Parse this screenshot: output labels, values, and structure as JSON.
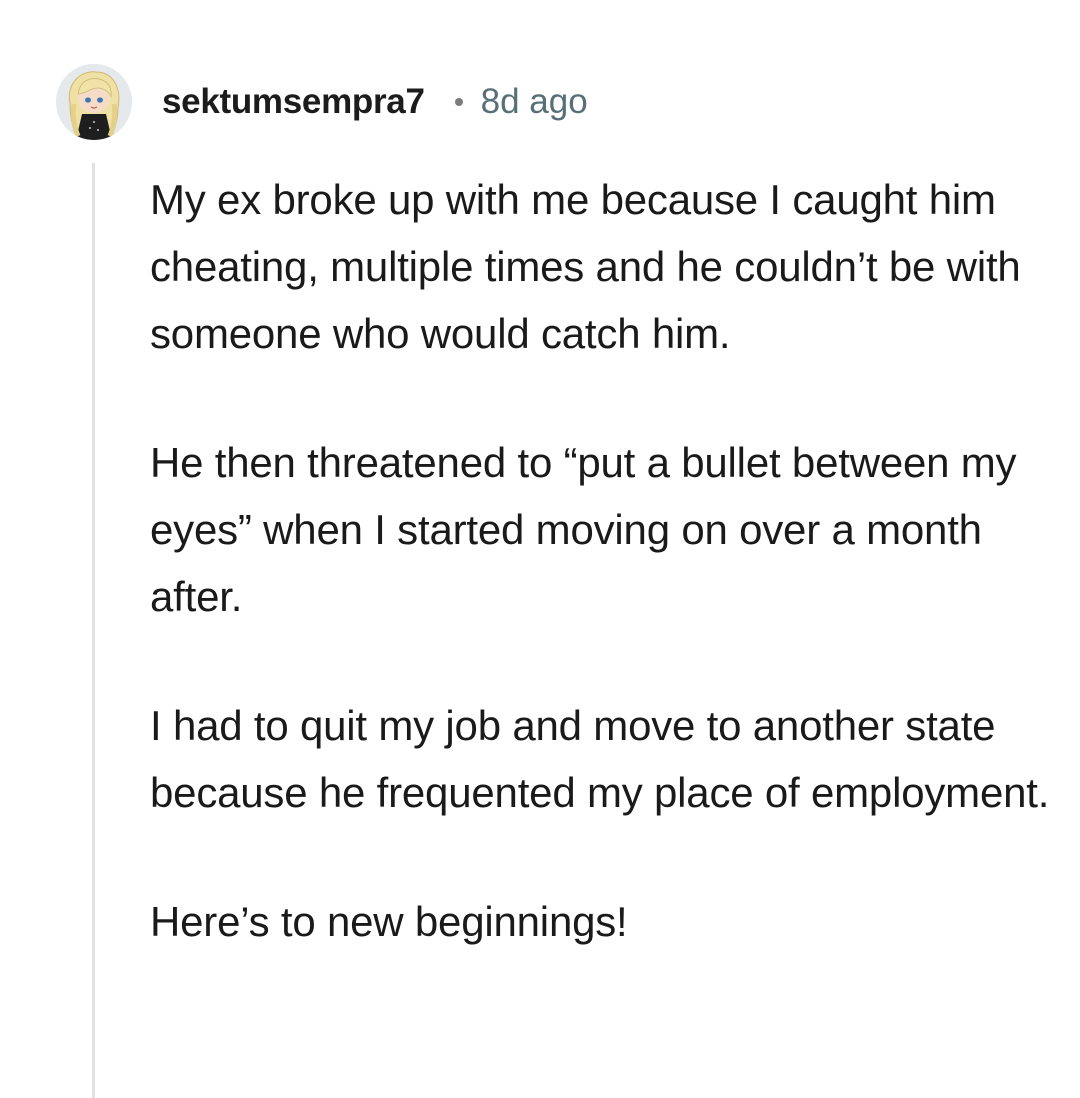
{
  "comment": {
    "author": "sektumsempra7",
    "timestamp": "8d ago",
    "avatar_icon": "user-avatar-blonde-girl",
    "paragraphs": [
      "My ex broke up with me because I caught him cheating, multiple times and he couldn’t be with someone who would catch him.",
      "He then threatened to “put a bullet between my eyes” when I started moving on over a month after.",
      "I had to quit my job and move to another state because he frequented my place of employment.",
      "Here’s to new beginnings!"
    ]
  },
  "colors": {
    "text": "#1a1a1b",
    "timestamp": "#576f76",
    "thread_line": "#e2e2e2",
    "background": "#ffffff"
  }
}
